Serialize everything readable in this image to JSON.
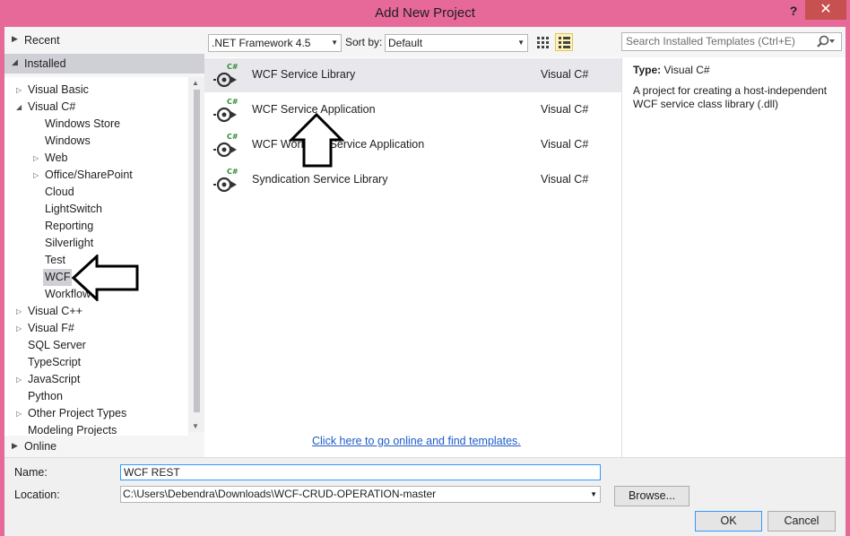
{
  "window": {
    "title": "Add New Project",
    "help_label": "?",
    "close_label": "✕"
  },
  "left_nav": {
    "recent_label": "Recent",
    "installed_label": "Installed",
    "online_label": "Online",
    "tree": [
      {
        "label": "Visual Basic",
        "level": 0,
        "expander": "collapsed"
      },
      {
        "label": "Visual C#",
        "level": 0,
        "expander": "expanded"
      },
      {
        "label": "Windows Store",
        "level": 1,
        "expander": "none"
      },
      {
        "label": "Windows",
        "level": 1,
        "expander": "none"
      },
      {
        "label": "Web",
        "level": 1,
        "expander": "collapsed"
      },
      {
        "label": "Office/SharePoint",
        "level": 1,
        "expander": "collapsed"
      },
      {
        "label": "Cloud",
        "level": 1,
        "expander": "none"
      },
      {
        "label": "LightSwitch",
        "level": 1,
        "expander": "none"
      },
      {
        "label": "Reporting",
        "level": 1,
        "expander": "none"
      },
      {
        "label": "Silverlight",
        "level": 1,
        "expander": "none"
      },
      {
        "label": "Test",
        "level": 1,
        "expander": "none"
      },
      {
        "label": "WCF",
        "level": 1,
        "expander": "none",
        "selected": true
      },
      {
        "label": "Workflow",
        "level": 1,
        "expander": "none"
      },
      {
        "label": "Visual C++",
        "level": 0,
        "expander": "collapsed"
      },
      {
        "label": "Visual F#",
        "level": 0,
        "expander": "collapsed"
      },
      {
        "label": "SQL Server",
        "level": 0,
        "expander": "none"
      },
      {
        "label": "TypeScript",
        "level": 0,
        "expander": "none"
      },
      {
        "label": "JavaScript",
        "level": 0,
        "expander": "collapsed"
      },
      {
        "label": "Python",
        "level": 0,
        "expander": "none"
      },
      {
        "label": "Other Project Types",
        "level": 0,
        "expander": "collapsed"
      },
      {
        "label": "Modeling Projects",
        "level": 0,
        "expander": "none"
      }
    ]
  },
  "toolbar": {
    "framework": ".NET Framework 4.5",
    "sort_label": "Sort by:",
    "sort_value": "Default",
    "search_placeholder": "Search Installed Templates (Ctrl+E)"
  },
  "templates": [
    {
      "name": "WCF Service Library",
      "language": "Visual C#",
      "selected": true
    },
    {
      "name": "WCF Service Application",
      "language": "Visual C#"
    },
    {
      "name": "WCF Workflow Service Application",
      "language": "Visual C#"
    },
    {
      "name": "Syndication Service Library",
      "language": "Visual C#"
    }
  ],
  "online_link": "Click here to go online and find templates.",
  "description": {
    "type_label": "Type:",
    "type_value": "Visual C#",
    "text": "A project for creating a host-independent WCF service class library (.dll)"
  },
  "form": {
    "name_label": "Name:",
    "name_value": "WCF REST",
    "location_label": "Location:",
    "location_value": "C:\\Users\\Debendra\\Downloads\\WCF-CRUD-OPERATION-master",
    "browse_label": "Browse...",
    "ok_label": "OK",
    "cancel_label": "Cancel"
  },
  "colors": {
    "titlebar": "#e6699a",
    "close_button": "#c75050",
    "link": "#1e5cc8",
    "selection": "#cfcfd6"
  }
}
